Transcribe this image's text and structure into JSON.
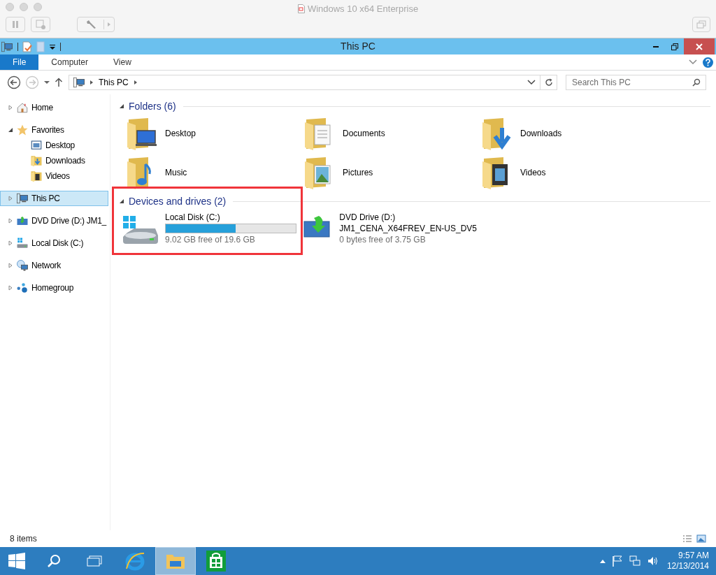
{
  "vm_window": {
    "title": "Windows 10 x64 Enterprise"
  },
  "window": {
    "title": "This PC"
  },
  "ribbon_tabs": [
    {
      "label": "File",
      "selected": true
    },
    {
      "label": "Computer",
      "selected": false
    },
    {
      "label": "View",
      "selected": false
    }
  ],
  "address_bar": {
    "path": [
      "This PC"
    ]
  },
  "search": {
    "placeholder": "Search This PC"
  },
  "sidebar": {
    "items": [
      {
        "label": "Home",
        "kind": "home",
        "expanded": false,
        "selected": false
      },
      {
        "label": "Favorites",
        "kind": "star",
        "expanded": true,
        "selected": false,
        "children": [
          {
            "label": "Desktop",
            "kind": "desktop",
            "selected": false
          },
          {
            "label": "Downloads",
            "kind": "downloads",
            "selected": false
          },
          {
            "label": "Videos",
            "kind": "videos",
            "selected": false
          }
        ]
      },
      {
        "label": "This PC",
        "kind": "pc",
        "expanded": false,
        "selected": true
      },
      {
        "label": "DVD Drive (D:) JM1_",
        "kind": "dvd",
        "expanded": false,
        "selected": false
      },
      {
        "label": "Local Disk (C:)",
        "kind": "disk",
        "expanded": false,
        "selected": false
      },
      {
        "label": "Network",
        "kind": "network",
        "expanded": false,
        "selected": false
      },
      {
        "label": "Homegroup",
        "kind": "homegroup",
        "expanded": false,
        "selected": false
      }
    ]
  },
  "groups": [
    {
      "title": "Folders (6)",
      "expanded": true,
      "kind": "folders",
      "items": [
        {
          "label": "Desktop",
          "kind": "desktop"
        },
        {
          "label": "Documents",
          "kind": "documents"
        },
        {
          "label": "Downloads",
          "kind": "downloads"
        },
        {
          "label": "Music",
          "kind": "music"
        },
        {
          "label": "Pictures",
          "kind": "pictures"
        },
        {
          "label": "Videos",
          "kind": "videos"
        }
      ]
    },
    {
      "title": "Devices and drives (2)",
      "expanded": true,
      "kind": "drives",
      "highlighted": true,
      "items": [
        {
          "label": "Local Disk (C:)",
          "kind": "disk",
          "level": 0.54,
          "detail": "9.02 GB free of 19.6 GB"
        },
        {
          "label": "DVD Drive (D:)",
          "kind": "dvd",
          "volume": "JM1_CENA_X64FREV_EN-US_DV5",
          "detail": "0 bytes free of 3.75 GB"
        }
      ]
    }
  ],
  "status_bar": {
    "items": "8 items"
  },
  "taskbar": {
    "apps": [
      {
        "kind": "ie",
        "selected": false
      },
      {
        "kind": "explorer",
        "selected": true
      },
      {
        "kind": "store",
        "selected": false
      }
    ],
    "time": "9:57 AM",
    "date": "12/13/2014"
  }
}
